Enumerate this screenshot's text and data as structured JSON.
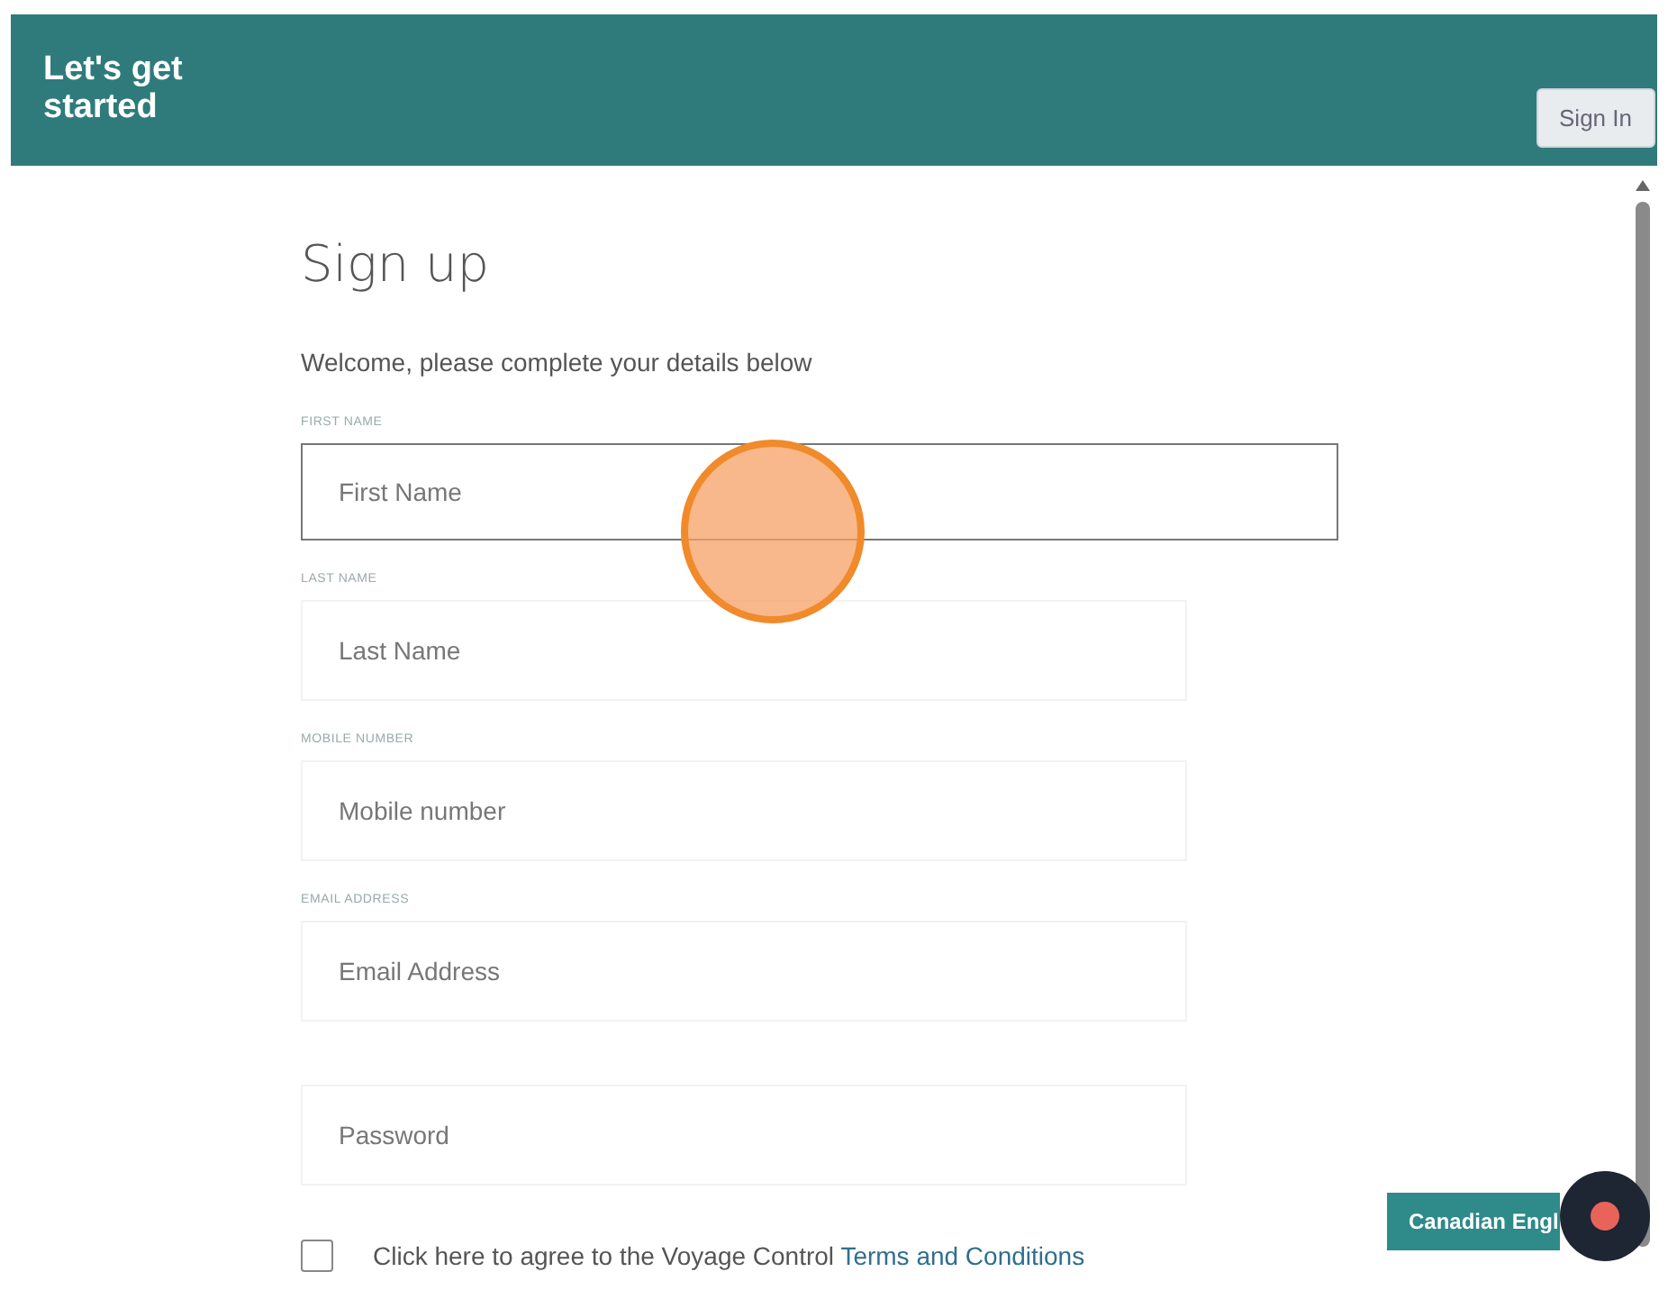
{
  "header": {
    "title": "Let's get started",
    "sign_in": "Sign In"
  },
  "form": {
    "heading": "Sign up",
    "intro": "Welcome, please complete your details below",
    "fields": [
      {
        "label": "FIRST NAME",
        "placeholder": "First Name",
        "focused": true
      },
      {
        "label": "LAST NAME",
        "placeholder": "Last Name",
        "focused": false
      },
      {
        "label": "MOBILE NUMBER",
        "placeholder": "Mobile number",
        "focused": false
      },
      {
        "label": "EMAIL ADDRESS",
        "placeholder": "Email Address",
        "focused": false
      },
      {
        "placeholder": "Password",
        "focused": false
      }
    ],
    "terms": {
      "checked": false,
      "text": "Click here to agree to the Voyage Control ",
      "link": "Terms and Conditions"
    }
  },
  "language_button": "Canadian Engl"
}
